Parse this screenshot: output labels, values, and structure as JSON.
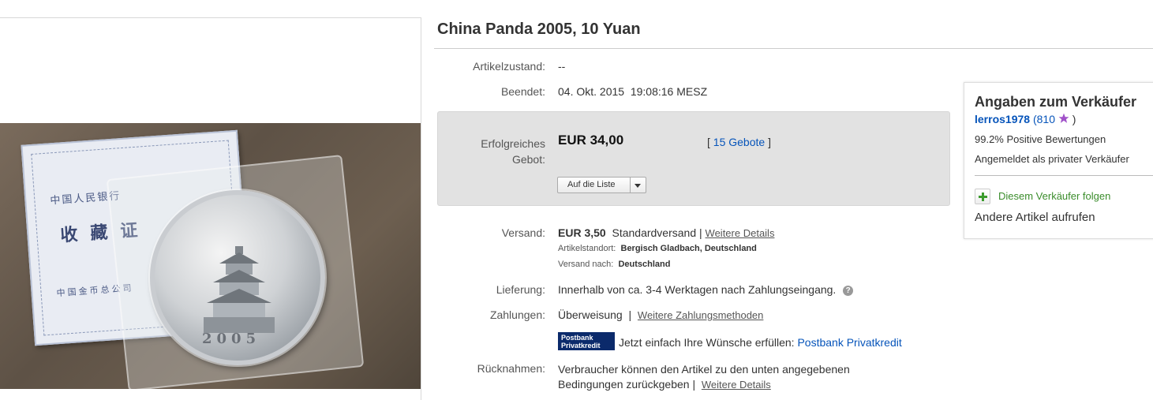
{
  "item": {
    "title": "China Panda 2005, 10 Yuan"
  },
  "photo": {
    "certificate_bank": "中国人民银行",
    "certificate_title": "收藏证",
    "certificate_footer": "中国金币总公司",
    "coin_year": "2005"
  },
  "details": {
    "condition_label": "Artikelzustand:",
    "condition_value": "--",
    "ended_label": "Beendet:",
    "ended_date": "04. Okt. 2015",
    "ended_time": "19:08:16 MESZ"
  },
  "bid": {
    "label_line1": "Erfolgreiches",
    "label_line2": "Gebot:",
    "price": "EUR 34,00",
    "bracket_open": "[",
    "bids_link": "15 Gebote",
    "bracket_close": "]",
    "watch_button": "Auf die Liste"
  },
  "shipping": {
    "label": "Versand:",
    "cost": "EUR 3,50",
    "method": "Standardversand",
    "separator": "|",
    "details_link": "Weitere Details",
    "location_label": "Artikelstandort:",
    "location_value": "Bergisch Gladbach, Deutschland",
    "ships_to_label": "Versand nach:",
    "ships_to_value": "Deutschland"
  },
  "delivery": {
    "label": "Lieferung:",
    "text": "Innerhalb von ca. 3-4 Werktagen nach Zahlungseingang.",
    "help_icon": "?"
  },
  "payments": {
    "label": "Zahlungen:",
    "method": "Überweisung",
    "separator": "|",
    "more_link": "Weitere Zahlungsmethoden",
    "postbank_logo_line1": "Postbank",
    "postbank_logo_line2": "Privatkredit",
    "credit_text": "Jetzt einfach Ihre Wünsche erfüllen:",
    "credit_link": "Postbank Privatkredit"
  },
  "returns": {
    "label": "Rücknahmen:",
    "line1": "Verbraucher können den Artikel zu den unten angegebenen",
    "line2": "Bedingungen zurückgeben |",
    "details_link": "Weitere Details"
  },
  "seller": {
    "heading": "Angaben zum Verkäufer",
    "name": "lerros1978",
    "score_open": "(810",
    "score_close": ")",
    "star_color": "#a152c9",
    "positive": "99.2% Positive Bewertungen",
    "type": "Angemeldet als privater Verkäufer",
    "follow": "Diesem Verkäufer folgen",
    "other_items": "Andere Artikel aufrufen"
  }
}
